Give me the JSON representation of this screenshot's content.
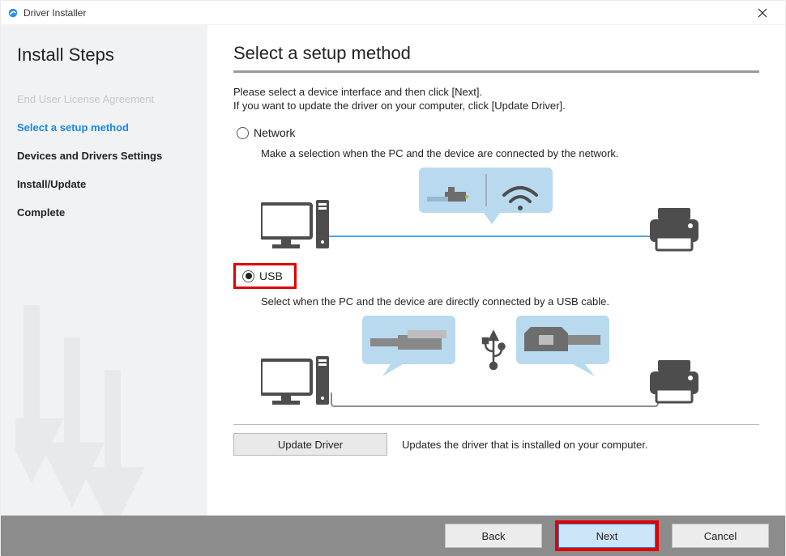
{
  "window": {
    "title": "Driver Installer"
  },
  "sidebar": {
    "heading": "Install Steps",
    "steps": [
      {
        "label": "End User License Agreement",
        "state": "done"
      },
      {
        "label": "Select a setup method",
        "state": "current"
      },
      {
        "label": "Devices and Drivers Settings",
        "state": "pending"
      },
      {
        "label": "Install/Update",
        "state": "pending"
      },
      {
        "label": "Complete",
        "state": "pending"
      }
    ]
  },
  "main": {
    "heading": "Select a setup method",
    "intro1": "Please select a device interface and then click [Next].",
    "intro2": "If you want to update the driver on your computer, click [Update Driver].",
    "network": {
      "label": "Network",
      "desc": "Make a selection when the PC and the device are connected by the network."
    },
    "usb": {
      "label": "USB",
      "desc": "Select when the PC and the device are directly connected by a USB cable."
    },
    "update": {
      "button": "Update Driver",
      "text": "Updates the driver that is installed on your computer."
    }
  },
  "footer": {
    "back": "Back",
    "next": "Next",
    "cancel": "Cancel"
  }
}
